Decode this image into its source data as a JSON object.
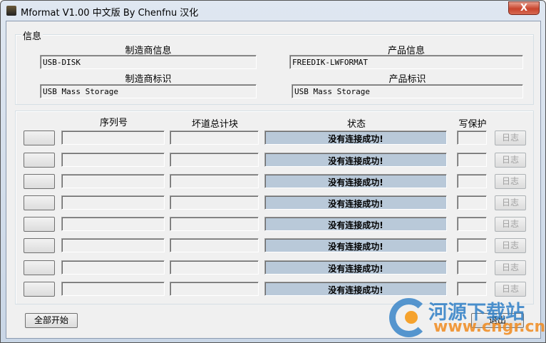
{
  "window": {
    "title": "Mformat V1.00 中文版 By Chenfnu 汉化",
    "close": "X"
  },
  "info": {
    "group_label": "信息",
    "vendor_label": "制造商信息",
    "vendor_value": "USB-DISK",
    "product_label": "产品信息",
    "product_value": "FREEDIK-LWFORMAT",
    "vendor_id_label": "制造商标识",
    "vendor_id_value": "USB Mass Storage",
    "product_id_label": "产品标识",
    "product_id_value": "USB Mass Storage"
  },
  "devices": {
    "headers": {
      "serial": "序列号",
      "bad_blocks": "坏道总计块",
      "status": "状态",
      "write_protect": "写保护"
    },
    "rows": [
      {
        "status": "没有连接成功!",
        "log": "日志"
      },
      {
        "status": "没有连接成功!",
        "log": "日志"
      },
      {
        "status": "没有连接成功!",
        "log": "日志"
      },
      {
        "status": "没有连接成功!",
        "log": "日志"
      },
      {
        "status": "没有连接成功!",
        "log": "日志"
      },
      {
        "status": "没有连接成功!",
        "log": "日志"
      },
      {
        "status": "没有连接成功!",
        "log": "日志"
      },
      {
        "status": "没有连接成功!",
        "log": "日志"
      }
    ]
  },
  "buttons": {
    "start_all": "全部开始",
    "exit": "退出"
  },
  "watermark": {
    "name": "河源下载站",
    "url": "www.cngr.cn"
  }
}
